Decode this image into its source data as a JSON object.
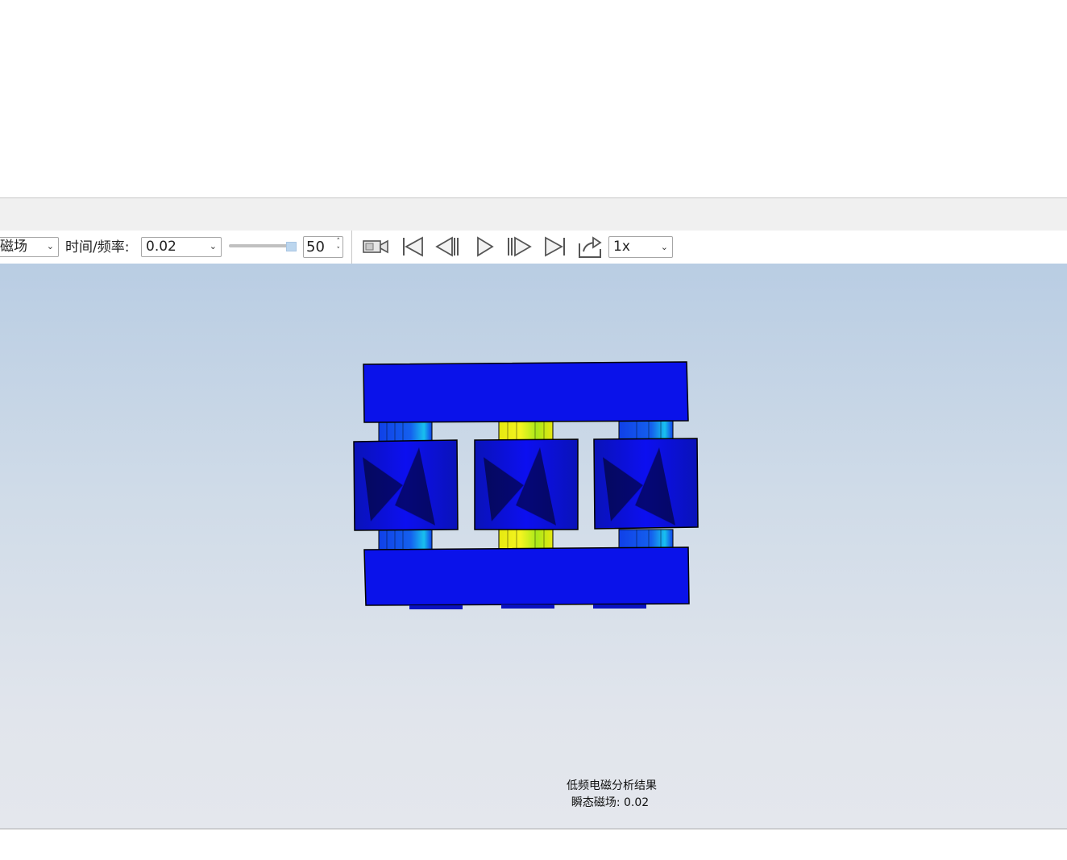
{
  "toolbar": {
    "result_select_value": "磁场",
    "time_label": "时间/频率:",
    "time_select_value": "0.02",
    "frame_value": "50",
    "speed_value": "1x"
  },
  "icons": {
    "record": "video-camera-icon",
    "first": "skip-to-start-icon",
    "prev": "step-back-icon",
    "play": "play-icon",
    "next": "step-forward-icon",
    "last": "skip-to-end-icon",
    "export": "export-icon"
  },
  "viewport": {
    "caption_title": "低频电磁分析结果",
    "caption_sub": "瞬态磁场: 0.02"
  },
  "colors": {
    "field_low": "#0a10e6",
    "field_mid": "#1aa8e8",
    "field_high": "#f0f015",
    "background_top": "#b9cde3",
    "background_bottom": "#e4e7ed"
  }
}
